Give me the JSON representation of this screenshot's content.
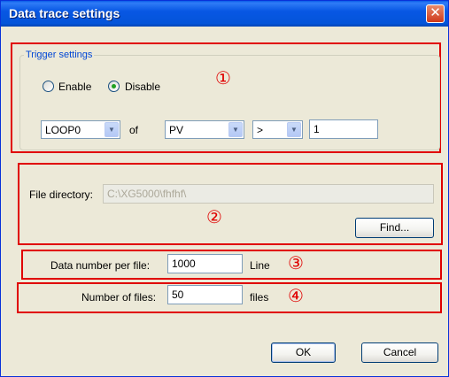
{
  "window": {
    "title": "Data trace settings"
  },
  "trigger": {
    "legend": "Trigger settings",
    "enable_label": "Enable",
    "disable_label": "Disable",
    "selected": "Disable",
    "source_combo": "LOOP0",
    "of_label": "of",
    "variable_combo": "PV",
    "operator_combo": ">",
    "value": "1"
  },
  "file": {
    "directory_label": "File directory:",
    "directory_value": "C:\\XG5000\\fhfhf\\",
    "find_label": "Find..."
  },
  "data_number": {
    "label": "Data number per file:",
    "value": "1000",
    "unit": "Line"
  },
  "num_files": {
    "label": "Number of files:",
    "value": "50",
    "unit": "files"
  },
  "annotations": {
    "one": "①",
    "two": "②",
    "three": "③",
    "four": "④"
  },
  "buttons": {
    "ok": "OK",
    "cancel": "Cancel"
  },
  "colors": {
    "annotation_red": "#e00000",
    "titlebar_blue": "#0054e3",
    "legend_blue": "#0046d5"
  },
  "icons": {
    "close": "close-icon",
    "dropdown": "chevron-down-icon"
  }
}
